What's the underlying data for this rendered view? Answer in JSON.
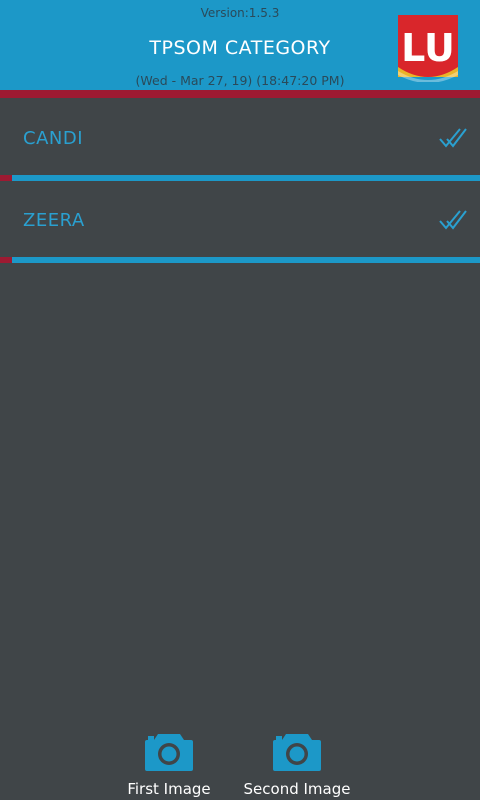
{
  "header": {
    "version": "Version:1.5.3",
    "title": "TPSOM CATEGORY",
    "datetime": "(Wed - Mar 27, 19) (18:47:20 PM)",
    "logo_text": "LU"
  },
  "categories": [
    {
      "label": "CANDI",
      "status_icon": "double-check-icon"
    },
    {
      "label": "ZEERA",
      "status_icon": "double-check-icon"
    }
  ],
  "footer": {
    "first_image_label": "First Image",
    "second_image_label": "Second Image",
    "icon": "camera-icon"
  },
  "colors": {
    "header_bg": "#1c98c8",
    "accent_red": "#9d1a32",
    "background": "#404548",
    "label_blue": "#2aa0d0"
  }
}
